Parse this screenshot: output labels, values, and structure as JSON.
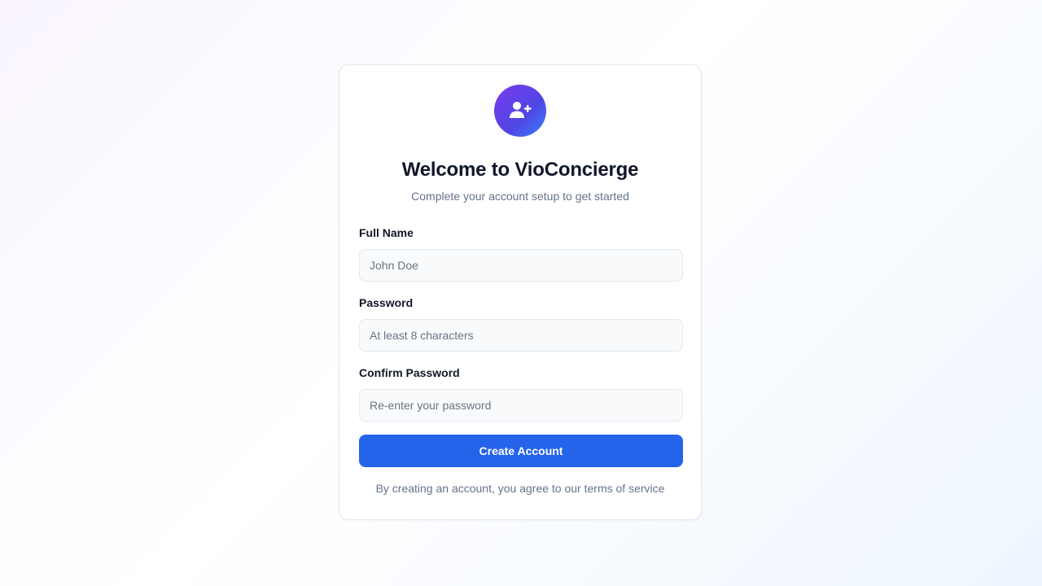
{
  "header": {
    "icon": "user-plus-icon",
    "title": "Welcome to VioConcierge",
    "subtitle": "Complete your account setup to get started"
  },
  "form": {
    "full_name": {
      "label": "Full Name",
      "placeholder": "John Doe",
      "value": ""
    },
    "password": {
      "label": "Password",
      "placeholder": "At least 8 characters",
      "value": ""
    },
    "confirm_password": {
      "label": "Confirm Password",
      "placeholder": "Re-enter your password",
      "value": ""
    },
    "submit_label": "Create Account"
  },
  "footer": {
    "terms_text": "By creating an account, you agree to our terms of service"
  },
  "colors": {
    "primary": "#2563eb",
    "avatar_gradient_start": "#7c3aed",
    "avatar_gradient_end": "#3b82f6",
    "title": "#0f172a",
    "muted": "#64748b"
  }
}
